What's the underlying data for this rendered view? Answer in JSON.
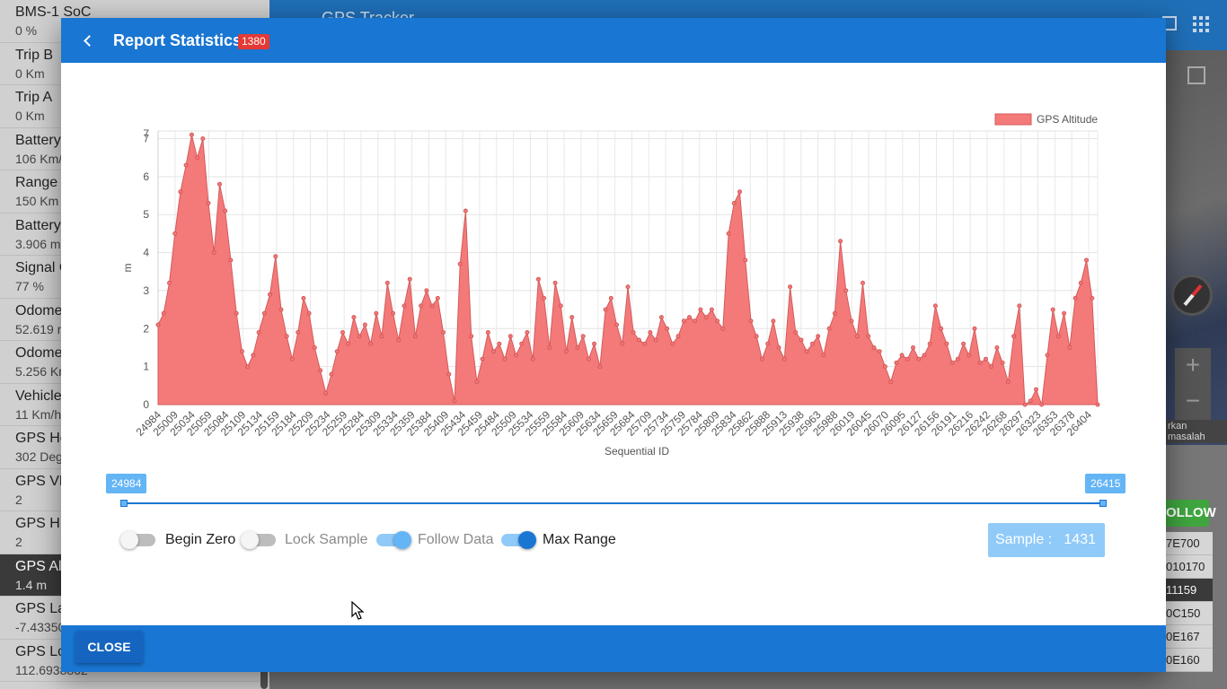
{
  "background": {
    "app_title": "GPS Tracker",
    "sidebar": [
      {
        "label": "BMS-1 SoC",
        "value": "0 %"
      },
      {
        "label": "Trip B",
        "value": "0 Km"
      },
      {
        "label": "Trip A",
        "value": "0 Km"
      },
      {
        "label": "Battery",
        "value": "106 Km/"
      },
      {
        "label": "Range A",
        "value": "150 Km"
      },
      {
        "label": "Battery",
        "value": "3.906 m"
      },
      {
        "label": "Signal C",
        "value": "77 %"
      },
      {
        "label": "Odome",
        "value": "52.619 m"
      },
      {
        "label": "Odome",
        "value": "5.256 Km"
      },
      {
        "label": "Vehicle",
        "value": "11 Km/h"
      },
      {
        "label": "GPS He",
        "value": "302 Deg"
      },
      {
        "label": "GPS VD",
        "value": "2"
      },
      {
        "label": "GPS HD",
        "value": "2"
      },
      {
        "label": "GPS Alt",
        "value": "1.4 m"
      },
      {
        "label": "GPS La",
        "value": "-7.43350"
      },
      {
        "label": "GPS Lo",
        "value": "112.6938862"
      }
    ],
    "active_sidebar_index": 13,
    "map_caption": "rkan masalah",
    "follow_button": "OLLOW",
    "list_rows": [
      "7E700",
      "010170",
      "11159",
      "0C150",
      "0E167",
      "0E160"
    ],
    "map_zoom_in": "+",
    "map_zoom_out": "−"
  },
  "modal": {
    "title": "Report Statistics",
    "badge": "1380",
    "close_label": "CLOSE"
  },
  "range": {
    "min_label": "24984",
    "max_label": "26415"
  },
  "toggles": [
    {
      "label": "Begin Zero",
      "on": false
    },
    {
      "label": "Lock Sample",
      "on": false
    },
    {
      "label": "Follow Data",
      "on": true
    },
    {
      "label": "Max Range",
      "on": true
    }
  ],
  "sample": {
    "label": "Sample :",
    "value": "1431"
  },
  "colors": {
    "header": "#1976d2",
    "badge": "#e53935",
    "area_fill": "#f47a7a",
    "area_line": "#d45a5a"
  },
  "chart_data": {
    "type": "area",
    "title": "",
    "xlabel": "Sequential ID",
    "ylabel": "m",
    "ylim": [
      0,
      7.2
    ],
    "y_ticks": [
      0,
      1,
      2,
      3,
      4,
      5,
      6,
      7,
      7
    ],
    "legend": {
      "entries": [
        "GPS Altitude"
      ],
      "position": "top-right"
    },
    "grid": true,
    "x_tick_labels": [
      "24984",
      "25009",
      "25034",
      "25059",
      "25084",
      "25109",
      "25134",
      "25159",
      "25184",
      "25209",
      "25234",
      "25259",
      "25284",
      "25309",
      "25334",
      "25359",
      "25384",
      "25409",
      "25434",
      "25459",
      "25484",
      "25509",
      "25534",
      "25559",
      "25584",
      "25609",
      "25634",
      "25659",
      "25684",
      "25709",
      "25734",
      "25759",
      "25784",
      "25809",
      "25834",
      "25862",
      "25888",
      "25913",
      "25938",
      "25963",
      "25988",
      "26019",
      "26045",
      "26070",
      "26095",
      "26127",
      "26156",
      "26191",
      "26216",
      "26242",
      "26268",
      "26297",
      "26323",
      "26353",
      "26378",
      "26404"
    ],
    "series": [
      {
        "name": "GPS Altitude",
        "points": [
          [
            0,
            2.1
          ],
          [
            1,
            2.4
          ],
          [
            2,
            3.2
          ],
          [
            3,
            4.5
          ],
          [
            4,
            5.6
          ],
          [
            5,
            6.3
          ],
          [
            6,
            7.1
          ],
          [
            7,
            6.5
          ],
          [
            8,
            7.0
          ],
          [
            9,
            5.3
          ],
          [
            10,
            4.0
          ],
          [
            11,
            5.8
          ],
          [
            12,
            5.1
          ],
          [
            13,
            3.8
          ],
          [
            14,
            2.4
          ],
          [
            15,
            1.4
          ],
          [
            16,
            1.0
          ],
          [
            17,
            1.3
          ],
          [
            18,
            1.9
          ],
          [
            19,
            2.4
          ],
          [
            20,
            2.9
          ],
          [
            21,
            3.9
          ],
          [
            22,
            2.5
          ],
          [
            23,
            1.8
          ],
          [
            24,
            1.2
          ],
          [
            25,
            1.9
          ],
          [
            26,
            2.8
          ],
          [
            27,
            2.4
          ],
          [
            28,
            1.5
          ],
          [
            29,
            0.9
          ],
          [
            30,
            0.3
          ],
          [
            31,
            0.8
          ],
          [
            32,
            1.4
          ],
          [
            33,
            1.9
          ],
          [
            34,
            1.6
          ],
          [
            35,
            2.3
          ],
          [
            36,
            1.8
          ],
          [
            37,
            2.1
          ],
          [
            38,
            1.6
          ],
          [
            39,
            2.4
          ],
          [
            40,
            1.8
          ],
          [
            41,
            3.2
          ],
          [
            42,
            2.4
          ],
          [
            43,
            1.7
          ],
          [
            44,
            2.6
          ],
          [
            45,
            3.3
          ],
          [
            46,
            1.8
          ],
          [
            47,
            2.6
          ],
          [
            48,
            3.0
          ],
          [
            49,
            2.6
          ],
          [
            50,
            2.8
          ],
          [
            51,
            1.9
          ],
          [
            52,
            0.8
          ],
          [
            53,
            0.1
          ],
          [
            54,
            3.7
          ],
          [
            55,
            5.1
          ],
          [
            56,
            1.8
          ],
          [
            57,
            0.6
          ],
          [
            58,
            1.2
          ],
          [
            59,
            1.9
          ],
          [
            60,
            1.4
          ],
          [
            61,
            1.6
          ],
          [
            62,
            1.2
          ],
          [
            63,
            1.8
          ],
          [
            64,
            1.3
          ],
          [
            65,
            1.6
          ],
          [
            66,
            1.9
          ],
          [
            67,
            1.2
          ],
          [
            68,
            3.3
          ],
          [
            69,
            2.8
          ],
          [
            70,
            1.5
          ],
          [
            71,
            3.2
          ],
          [
            72,
            2.6
          ],
          [
            73,
            1.4
          ],
          [
            74,
            2.3
          ],
          [
            75,
            1.5
          ],
          [
            76,
            1.8
          ],
          [
            77,
            1.2
          ],
          [
            78,
            1.6
          ],
          [
            79,
            1.0
          ],
          [
            80,
            2.5
          ],
          [
            81,
            2.8
          ],
          [
            82,
            2.1
          ],
          [
            83,
            1.6
          ],
          [
            84,
            3.1
          ],
          [
            85,
            1.9
          ],
          [
            86,
            1.7
          ],
          [
            87,
            1.6
          ],
          [
            88,
            1.9
          ],
          [
            89,
            1.7
          ],
          [
            90,
            2.3
          ],
          [
            91,
            2.0
          ],
          [
            92,
            1.6
          ],
          [
            93,
            1.8
          ],
          [
            94,
            2.2
          ],
          [
            95,
            2.3
          ],
          [
            96,
            2.2
          ],
          [
            97,
            2.5
          ],
          [
            98,
            2.3
          ],
          [
            99,
            2.5
          ],
          [
            100,
            2.2
          ],
          [
            101,
            2.0
          ],
          [
            102,
            4.5
          ],
          [
            103,
            5.3
          ],
          [
            104,
            5.6
          ],
          [
            105,
            3.8
          ],
          [
            106,
            2.2
          ],
          [
            107,
            1.8
          ],
          [
            108,
            1.2
          ],
          [
            109,
            1.6
          ],
          [
            110,
            2.2
          ],
          [
            111,
            1.5
          ],
          [
            112,
            1.2
          ],
          [
            113,
            3.1
          ],
          [
            114,
            1.9
          ],
          [
            115,
            1.7
          ],
          [
            116,
            1.4
          ],
          [
            117,
            1.6
          ],
          [
            118,
            1.8
          ],
          [
            119,
            1.3
          ],
          [
            120,
            2.0
          ],
          [
            121,
            2.4
          ],
          [
            122,
            4.3
          ],
          [
            123,
            3.0
          ],
          [
            124,
            2.2
          ],
          [
            125,
            1.8
          ],
          [
            126,
            3.2
          ],
          [
            127,
            1.8
          ],
          [
            128,
            1.5
          ],
          [
            129,
            1.4
          ],
          [
            130,
            1.0
          ],
          [
            131,
            0.6
          ],
          [
            132,
            1.1
          ],
          [
            133,
            1.3
          ],
          [
            134,
            1.2
          ],
          [
            135,
            1.5
          ],
          [
            136,
            1.2
          ],
          [
            137,
            1.3
          ],
          [
            138,
            1.6
          ],
          [
            139,
            2.6
          ],
          [
            140,
            2.0
          ],
          [
            141,
            1.6
          ],
          [
            142,
            1.1
          ],
          [
            143,
            1.2
          ],
          [
            144,
            1.6
          ],
          [
            145,
            1.3
          ],
          [
            146,
            2.0
          ],
          [
            147,
            1.1
          ],
          [
            148,
            1.2
          ],
          [
            149,
            1.0
          ],
          [
            150,
            1.5
          ],
          [
            151,
            1.1
          ],
          [
            152,
            0.6
          ],
          [
            153,
            1.8
          ],
          [
            154,
            2.6
          ],
          [
            155,
            0.0
          ],
          [
            156,
            0.1
          ],
          [
            157,
            0.4
          ],
          [
            158,
            0.0
          ],
          [
            159,
            1.3
          ],
          [
            160,
            2.5
          ],
          [
            161,
            1.8
          ],
          [
            162,
            2.4
          ],
          [
            163,
            1.5
          ],
          [
            164,
            2.8
          ],
          [
            165,
            3.2
          ],
          [
            166,
            3.8
          ],
          [
            167,
            2.8
          ],
          [
            168,
            0.0
          ]
        ]
      }
    ]
  }
}
